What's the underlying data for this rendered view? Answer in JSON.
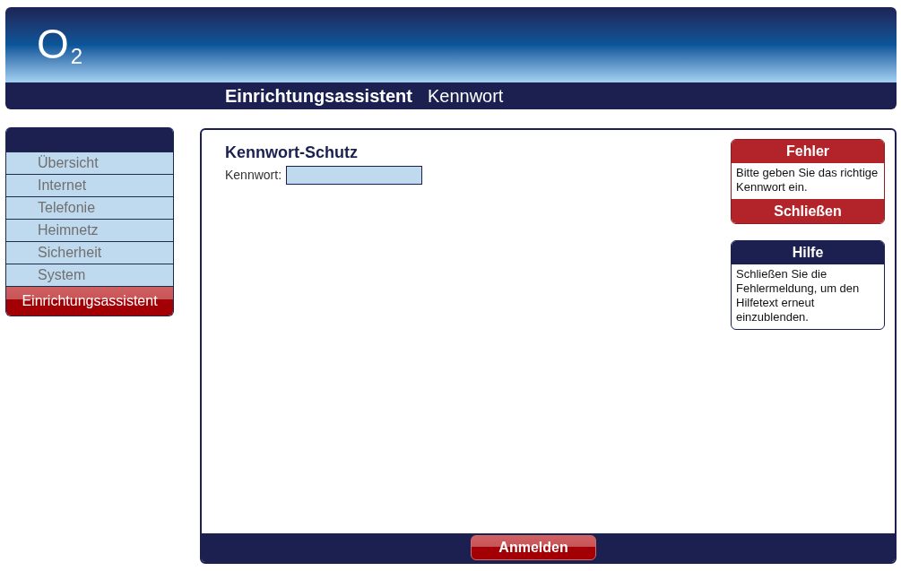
{
  "header": {
    "logo": "O$_{2}$",
    "title": "Einrichtungsassistent",
    "subtitle": "Kennwort"
  },
  "sidebar": {
    "items": [
      {
        "label": "Übersicht",
        "selected": false
      },
      {
        "label": "Internet",
        "selected": false
      },
      {
        "label": "Telefonie",
        "selected": false
      },
      {
        "label": "Heimnetz",
        "selected": false
      },
      {
        "label": "Sicherheit",
        "selected": false
      },
      {
        "label": "System",
        "selected": false
      },
      {
        "label": "Einrichtungsassistent",
        "selected": true
      }
    ]
  },
  "content": {
    "heading": "Kennwort-Schutz",
    "field": {
      "label": "Kennwort:"
    }
  },
  "panels": [
    {
      "kind": "error",
      "title": "Fehler",
      "text": "Bitte geben Sie das richtige Kennwort ein.",
      "button": "Schließen"
    },
    {
      "kind": "help",
      "title": "Hilfe",
      "text": "Schließen Sie die Fehlermeldung, um den Hilfetext erneut einzublenden."
    }
  ],
  "footer": {
    "button": "Anmelden"
  }
}
